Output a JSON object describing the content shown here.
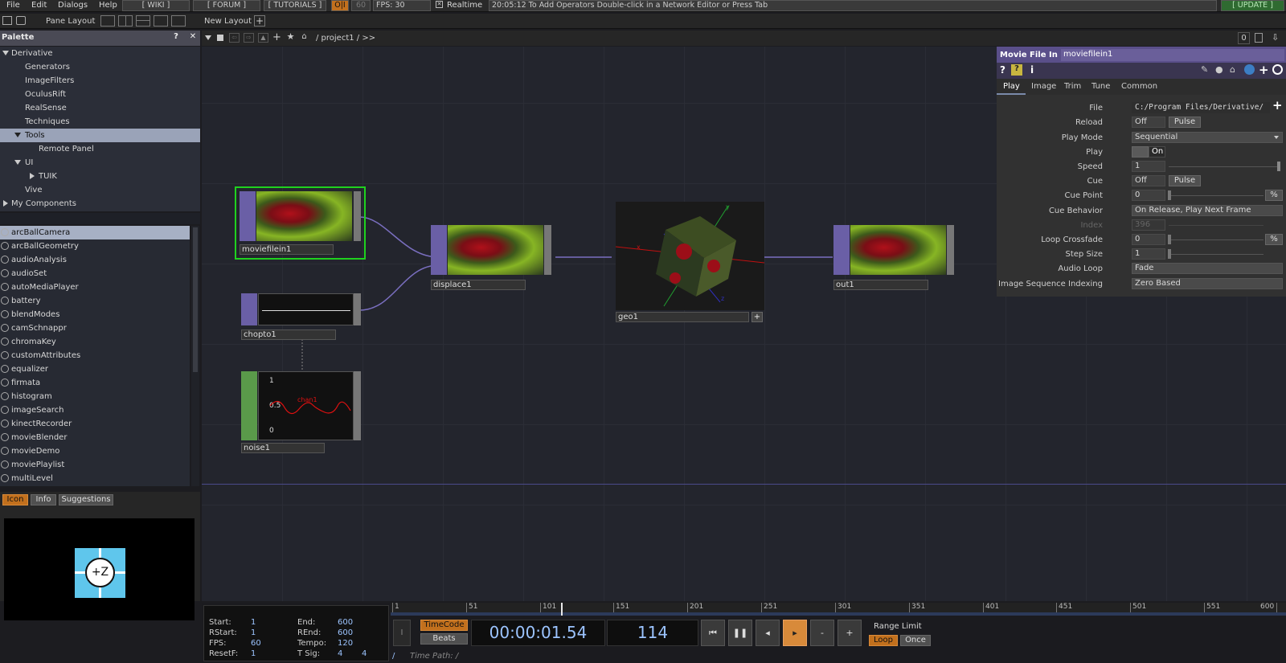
{
  "menubar": {
    "items": [
      "File",
      "Edit",
      "Dialogs",
      "Help"
    ],
    "wiki": "[ WIKI ]",
    "forum": "[ FORUM ]",
    "tutorials": "[ TUTORIALS ]",
    "oi": "O|I",
    "fps_target": "60",
    "fps": "FPS:  30",
    "realtime": "Realtime",
    "status": "20:05:12 To Add Operators Double-click in a Network Editor or Press Tab",
    "update": "[ UPDATE ]"
  },
  "toolbar": {
    "pane_layout": "Pane Layout",
    "new_layout": "New Layout",
    "path": "/ project1 / >>",
    "zero": "0"
  },
  "palette": {
    "title": "Palette",
    "help": "?",
    "close": "✕",
    "tree": [
      "Derivative",
      "Generators",
      "ImageFilters",
      "OculusRift",
      "RealSense",
      "Techniques",
      "Tools",
      "Remote Panel",
      "UI",
      "TUIK",
      "Vive",
      "My Components"
    ],
    "components": [
      "arcBallCamera",
      "arcBallGeometry",
      "audioAnalysis",
      "audioSet",
      "autoMediaPlayer",
      "battery",
      "blendModes",
      "camSchnappr",
      "chromaKey",
      "customAttributes",
      "equalizer",
      "firmata",
      "histogram",
      "imageSearch",
      "kinectRecorder",
      "movieBlender",
      "movieDemo",
      "moviePlaylist",
      "multiLevel"
    ],
    "tabs": [
      "Icon",
      "Info",
      "Suggestions"
    ],
    "preview_glyph": "+Z"
  },
  "nodes": {
    "moviefilein1": "moviefilein1",
    "displace1": "displace1",
    "chopto1": "chopto1",
    "noise1": "noise1",
    "geo1": "geo1",
    "out1": "out1",
    "noise_y1": "1",
    "noise_y05": "0.5",
    "noise_y0": "0",
    "noise_chan": "chan1",
    "geo_y": "y",
    "geo_x": "x",
    "geo_z": "z"
  },
  "params": {
    "type": "Movie File In",
    "name": "moviefilein1",
    "tabs": [
      "Play",
      "Image",
      "Trim",
      "Tune",
      "Common"
    ],
    "rows": [
      {
        "label": "File",
        "value": "C:/Program Files/Derivative/"
      },
      {
        "label": "Reload",
        "value": "Off",
        "btn": "Pulse"
      },
      {
        "label": "Play Mode",
        "value": "Sequential"
      },
      {
        "label": "Play",
        "value": "On"
      },
      {
        "label": "Speed",
        "value": "1"
      },
      {
        "label": "Cue",
        "value": "Off",
        "btn": "Pulse"
      },
      {
        "label": "Cue Point",
        "value": "0",
        "unit": "%"
      },
      {
        "label": "Cue Behavior",
        "value": "On Release, Play Next Frame"
      },
      {
        "label": "Index",
        "value": "396"
      },
      {
        "label": "Loop Crossfade",
        "value": "0",
        "unit": "%"
      },
      {
        "label": "Step Size",
        "value": "1"
      },
      {
        "label": "Audio Loop",
        "value": "Fade"
      },
      {
        "label": "Image Sequence Indexing",
        "value": "Zero Based"
      }
    ]
  },
  "timeline": {
    "ticks": [
      "1",
      "51",
      "101",
      "151",
      "201",
      "251",
      "301",
      "351",
      "401",
      "451",
      "501",
      "551",
      "600"
    ],
    "start_l": "Start:",
    "start": "1",
    "end_l": "End:",
    "end": "600",
    "rstart_l": "RStart:",
    "rstart": "1",
    "rend_l": "REnd:",
    "rend": "600",
    "fps_l": "FPS:",
    "fps": "60",
    "tempo_l": "Tempo:",
    "tempo": "120",
    "resetf_l": "ResetF:",
    "resetf": "1",
    "tsig_l": "T Sig:",
    "tsig_a": "4",
    "tsig_b": "4",
    "timecode": "TimeCode",
    "beats": "Beats",
    "time": "00:00:01.54",
    "frame": "114",
    "range_limit": "Range Limit",
    "loop": "Loop",
    "once": "Once",
    "time_path": "Time Path: /",
    "slash": "/"
  }
}
